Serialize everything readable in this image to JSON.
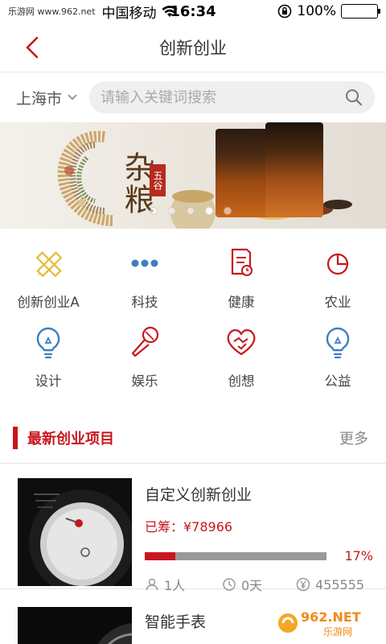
{
  "status": {
    "watermark": "乐游网 www.962.net",
    "carrier": "中国移动",
    "time": "16:34",
    "battery": "100%",
    "battery_level": 1.0
  },
  "nav": {
    "title": "创新创业"
  },
  "search": {
    "city": "上海市",
    "placeholder": "请输入关键词搜索"
  },
  "banner": {
    "title": "杂粮",
    "seal": "五谷",
    "dots": 5,
    "active_dot": 3
  },
  "categories": [
    {
      "label": "创新创业A",
      "icon": "pencil-ruler-icon",
      "color": "#e8b93a"
    },
    {
      "label": "科技",
      "icon": "more-dots-icon",
      "color": "#3d7fc1"
    },
    {
      "label": "健康",
      "icon": "clipboard-clock-icon",
      "color": "#c8161d"
    },
    {
      "label": "农业",
      "icon": "pie-chart-icon",
      "color": "#c8161d"
    },
    {
      "label": "设计",
      "icon": "lightbulb-icon",
      "color": "#3d7fc1"
    },
    {
      "label": "娱乐",
      "icon": "microphone-icon",
      "color": "#c8161d"
    },
    {
      "label": "创想",
      "icon": "heart-handshake-icon",
      "color": "#c8161d"
    },
    {
      "label": "公益",
      "icon": "lightbulb-icon",
      "color": "#3d7fc1"
    }
  ],
  "section": {
    "title": "最新创业项目",
    "more": "更多"
  },
  "projects": [
    {
      "name": "自定义创新创业",
      "raised": "已筹：¥78966",
      "progress": 0.17,
      "percent": "17%",
      "people": "1人",
      "days": "0天",
      "goal": "455555"
    },
    {
      "name": "智能手表"
    }
  ],
  "corner_logo": "962.NET 乐游网",
  "colors": {
    "accent": "#c8161d",
    "blue": "#3d7fc1",
    "yellow": "#e8b93a"
  }
}
